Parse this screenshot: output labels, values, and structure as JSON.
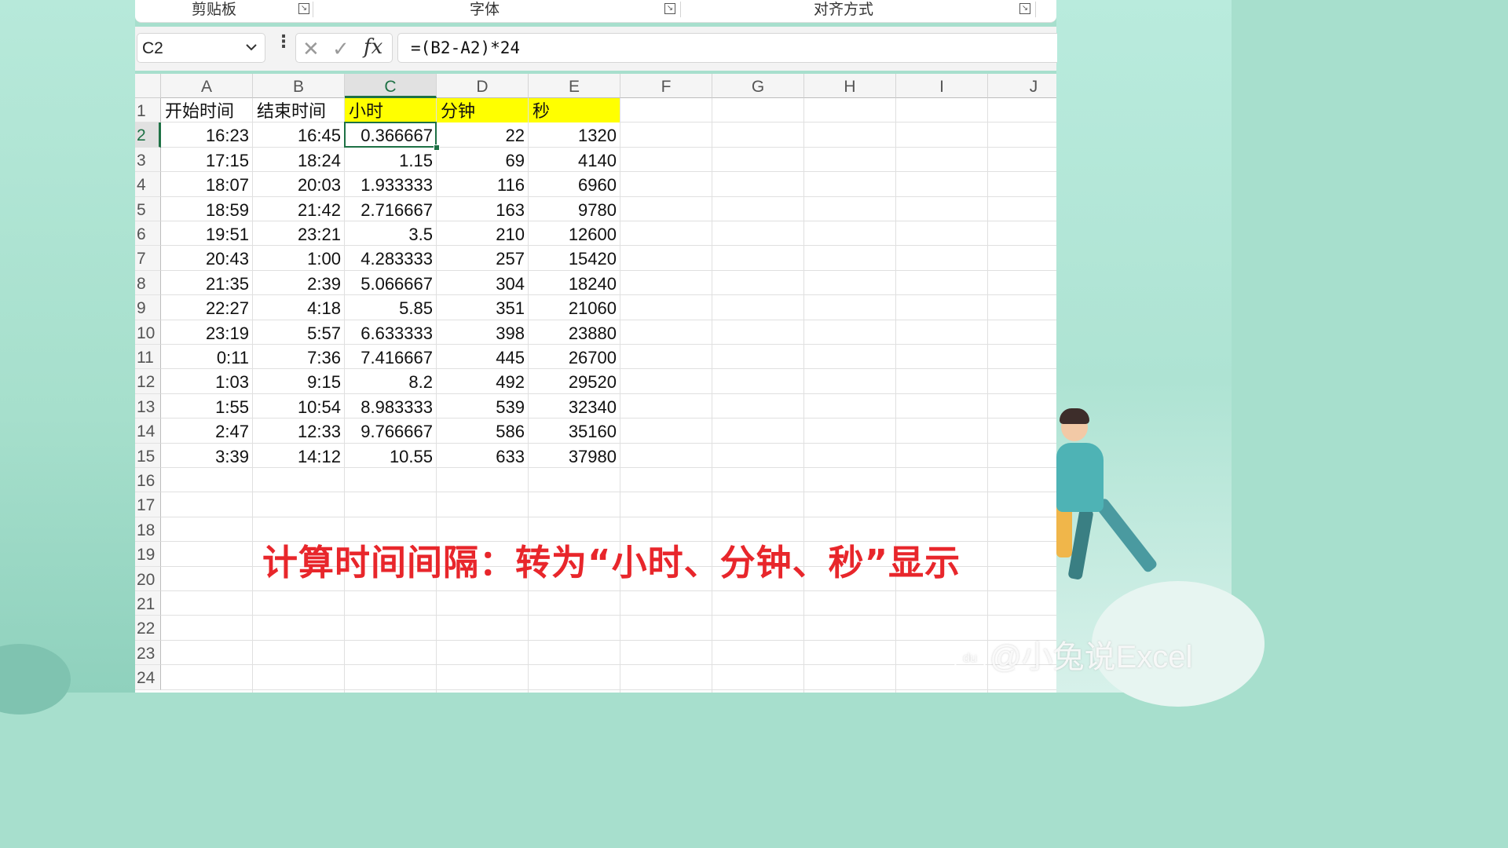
{
  "ribbon": {
    "groups": [
      "剪贴板",
      "字体",
      "对齐方式"
    ]
  },
  "formula_bar": {
    "name_box": "C2",
    "formula": "=(B2-A2)*24"
  },
  "sheet": {
    "columns": [
      "A",
      "B",
      "C",
      "D",
      "E",
      "F",
      "G",
      "H",
      "I",
      "J"
    ],
    "rows": [
      "1",
      "2",
      "3",
      "4",
      "5",
      "6",
      "7",
      "8",
      "9",
      "10",
      "11",
      "12",
      "13",
      "14",
      "15",
      "16",
      "17",
      "18",
      "19",
      "20",
      "21",
      "22",
      "23",
      "24"
    ],
    "header_row": [
      "开始时间",
      "结束时间",
      "小时",
      "分钟",
      "秒"
    ],
    "data": [
      [
        "16:23",
        "16:45",
        "0.366667",
        "22",
        "1320"
      ],
      [
        "17:15",
        "18:24",
        "1.15",
        "69",
        "4140"
      ],
      [
        "18:07",
        "20:03",
        "1.933333",
        "116",
        "6960"
      ],
      [
        "18:59",
        "21:42",
        "2.716667",
        "163",
        "9780"
      ],
      [
        "19:51",
        "23:21",
        "3.5",
        "210",
        "12600"
      ],
      [
        "20:43",
        "1:00",
        "4.283333",
        "257",
        "15420"
      ],
      [
        "21:35",
        "2:39",
        "5.066667",
        "304",
        "18240"
      ],
      [
        "22:27",
        "4:18",
        "5.85",
        "351",
        "21060"
      ],
      [
        "23:19",
        "5:57",
        "6.633333",
        "398",
        "23880"
      ],
      [
        "0:11",
        "7:36",
        "7.416667",
        "445",
        "26700"
      ],
      [
        "1:03",
        "9:15",
        "8.2",
        "492",
        "29520"
      ],
      [
        "1:55",
        "10:54",
        "8.983333",
        "539",
        "32340"
      ],
      [
        "2:47",
        "12:33",
        "9.766667",
        "586",
        "35160"
      ],
      [
        "3:39",
        "14:12",
        "10.55",
        "633",
        "37980"
      ]
    ],
    "highlight_color": "#ffff00",
    "selection_color": "#1e7145"
  },
  "caption": "计算时间间隔：转为“小时、分钟、秒”显示",
  "watermark": "@小兔说Excel"
}
